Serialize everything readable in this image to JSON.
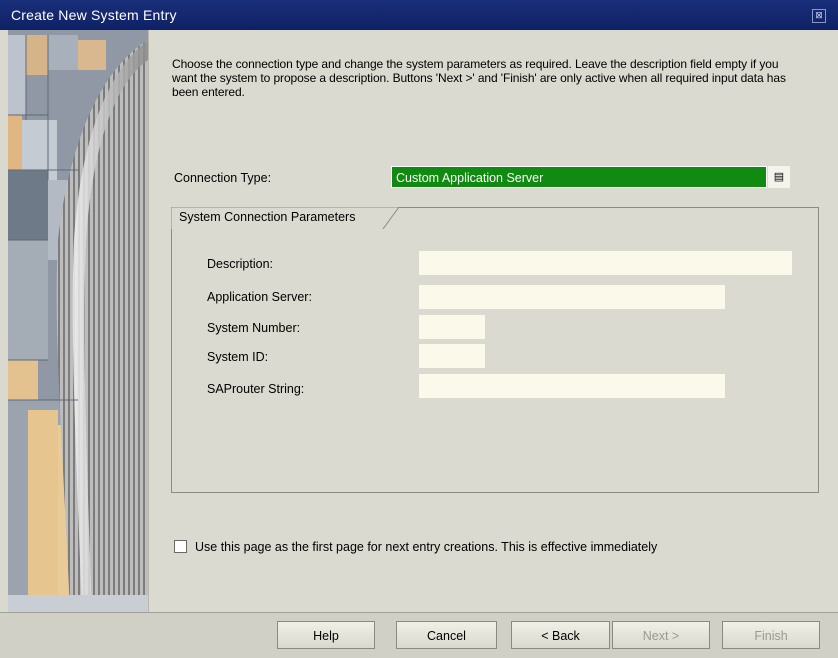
{
  "window": {
    "title": "Create New System Entry",
    "close_glyph": "⊠"
  },
  "instructions": "Choose the connection type and change the system parameters as required. Leave the description field empty if you want the system to propose a description. Buttons 'Next >' and 'Finish' are only active when all required input data has been entered.",
  "connection": {
    "label": "Connection Type:",
    "value": "Custom Application Server",
    "accent": "#108a10",
    "help_glyph": "▤"
  },
  "params": {
    "group_title": "System Connection Parameters",
    "description_label": "Description:",
    "description_value": "",
    "app_server_label": "Application Server:",
    "app_server_value": "",
    "sys_number_label": "System Number:",
    "sys_number_value": "",
    "sys_id_label": "System ID:",
    "sys_id_value": "",
    "saprouter_label": "SAProuter String:",
    "saprouter_value": ""
  },
  "first_page_option": {
    "label": "Use this page as the first page for next entry creations. This is effective immediately",
    "checked": false
  },
  "buttons": {
    "help": "Help",
    "cancel": "Cancel",
    "back": "< Back",
    "next": "Next >",
    "finish": "Finish"
  }
}
